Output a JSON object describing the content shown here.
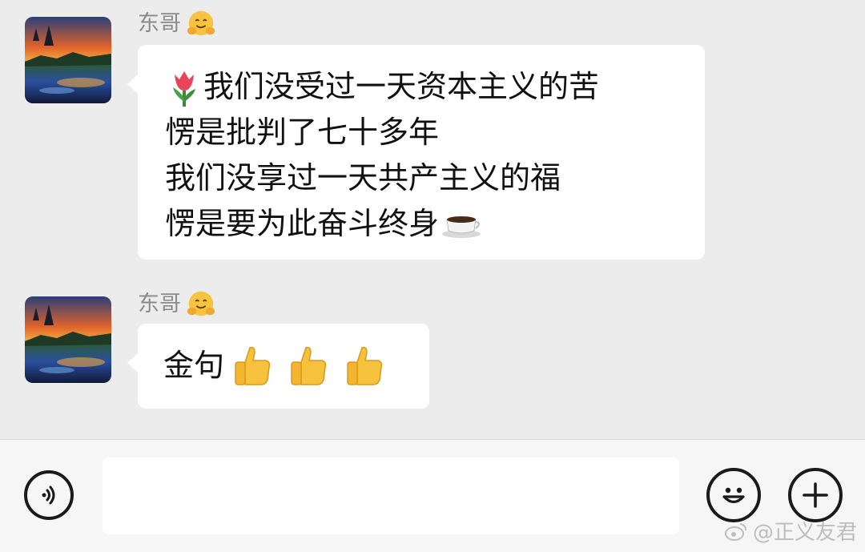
{
  "messages": [
    {
      "sender": "东哥",
      "lines": [
        "我们没受过一天资本主义的苦",
        "愣是批判了七十多年",
        "我们没享过一天共产主义的福",
        "愣是要为此奋斗终身"
      ],
      "lead_icon": "tulip-emoji",
      "trail_icon": "coffee-emoji"
    },
    {
      "sender": "东哥",
      "text": "金句",
      "icons": [
        "thumbs-up-emoji",
        "thumbs-up-emoji",
        "thumbs-up-emoji"
      ]
    }
  ],
  "input": {
    "placeholder": "",
    "voice_icon": "voice-icon",
    "emoji_icon": "smiley-icon",
    "plus_icon": "plus-icon"
  },
  "watermark": "@正义友君",
  "colors": {
    "chat_bg": "#ececec",
    "bubble": "#ffffff",
    "sender": "#8a8a8a",
    "input_bar": "#f6f6f6"
  }
}
